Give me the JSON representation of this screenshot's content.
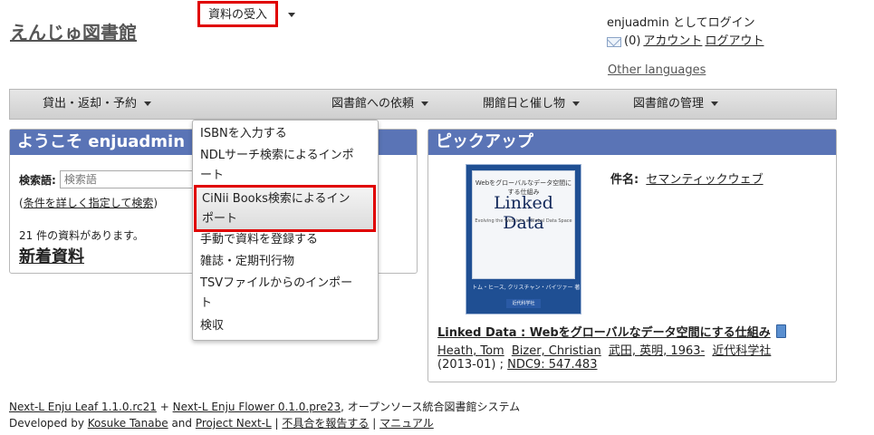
{
  "header": {
    "site_title": "えんじゅ図書館",
    "login_status": "enjuadmin としてログイン",
    "message_count": "(0)",
    "account_link": "アカウント",
    "logout_link": "ログアウト",
    "other_languages": "Other languages"
  },
  "nav": {
    "lending": "貸出・返却・予約",
    "acquisition": "資料の受入",
    "requests": "図書館への依頼",
    "events": "開館日と催し物",
    "admin": "図書館の管理"
  },
  "dropdown": {
    "items": [
      "ISBNを入力する",
      "NDLサーチ検索によるインポ",
      "ート",
      "CiNii Books検索によるイン",
      "ポート",
      "手動で資料を登録する",
      "雑誌・定期刊行物",
      "TSVファイルからのインポー",
      "ト",
      "検収"
    ]
  },
  "welcome": {
    "heading": "ようこそ enjuadmin",
    "search_label": "検索語:",
    "search_placeholder": "検索語",
    "advanced_search_prefix": "(",
    "advanced_search": "条件を詳しく指定して検索",
    "advanced_search_suffix": ")",
    "count_text": "21 件の資料があります。",
    "new_items": "新着資料"
  },
  "pickup": {
    "heading": "ピックアップ",
    "subject_label": "件名:",
    "subject_value": "セマンティックウェブ",
    "cover": {
      "subtitle": "Webをグローバルなデータ空間にする仕組み",
      "title": "Linked Data",
      "english": "Evolving the Web into a Global Data Space",
      "authors": "トム・ヒース, クリスチャン・バイツァー 著",
      "publisher": "近代科学社"
    },
    "book_title": "Linked Data : Webをグローバルなデータ空間にする仕組み",
    "authors": [
      "Heath, Tom",
      "Bizer, Christian",
      "武田, 英明, 1963-",
      "近代科学社"
    ],
    "date": "(2013-01) ;",
    "ndc": "NDC9: 547.483"
  },
  "footer": {
    "leaf": "Next-L Enju Leaf 1.1.0.rc21",
    "plus": "+",
    "flower": "Next-L Enju Flower 0.1.0.pre23",
    "system_desc": ", オープンソース統合図書館システム",
    "developed_by": "Developed by",
    "author": "Kosuke Tanabe",
    "and": "and",
    "project": "Project Next-L",
    "sep": "|",
    "report": "不具合を報告する",
    "manual": "マニュアル"
  }
}
